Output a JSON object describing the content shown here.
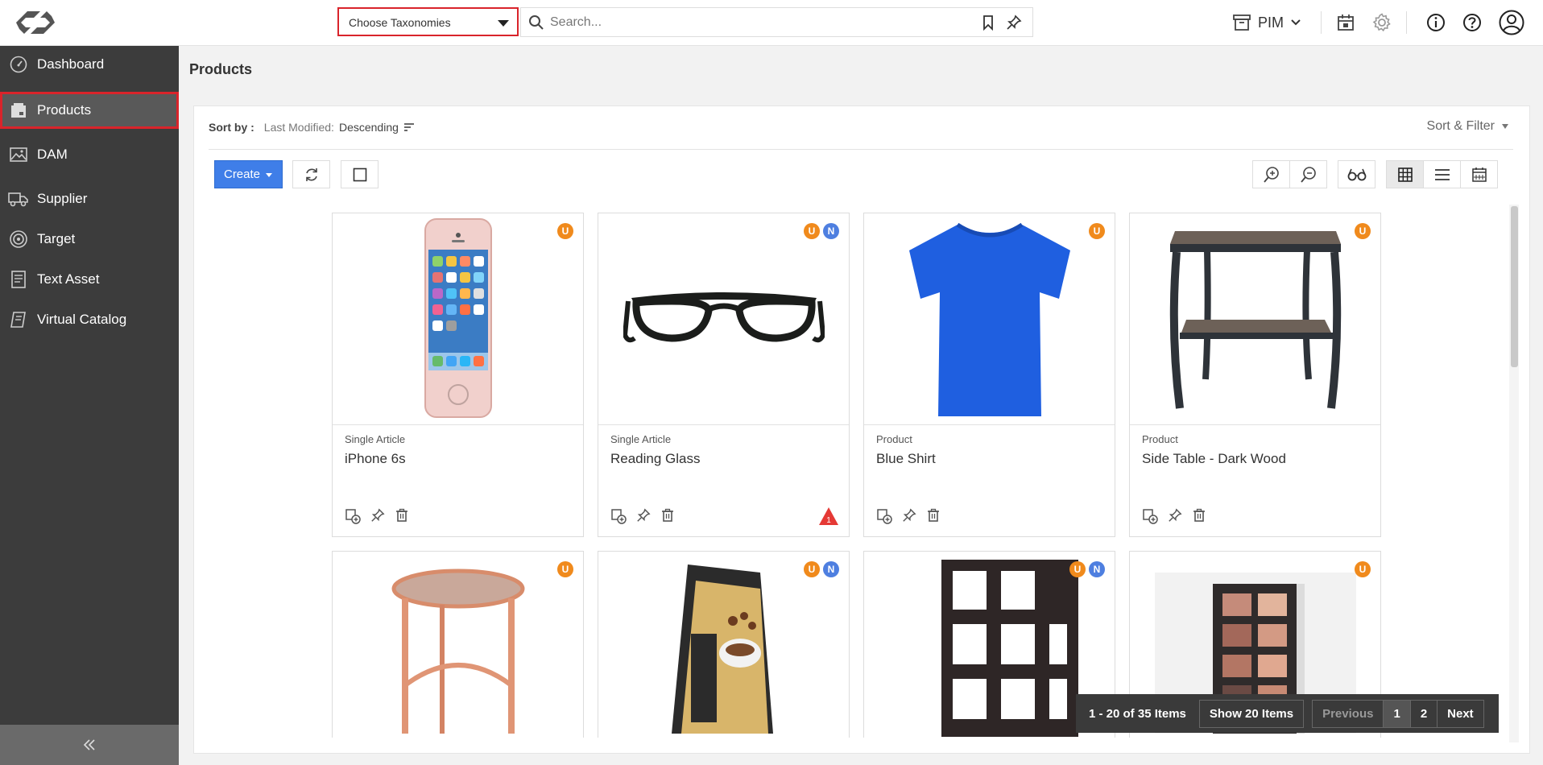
{
  "header": {
    "taxonomy_select": "Choose Taxonomies",
    "search_placeholder": "Search...",
    "workspace": "PIM"
  },
  "sidebar": {
    "items": [
      {
        "label": "Dashboard",
        "icon": "speedometer-icon"
      },
      {
        "label": "Products",
        "icon": "product-box-icon",
        "active": true
      },
      {
        "label": "DAM",
        "icon": "image-icon"
      },
      {
        "label": "Supplier",
        "icon": "truck-icon"
      },
      {
        "label": "Target",
        "icon": "target-icon"
      },
      {
        "label": "Text Asset",
        "icon": "document-icon"
      },
      {
        "label": "Virtual Catalog",
        "icon": "catalog-icon"
      }
    ]
  },
  "page": {
    "title": "Products"
  },
  "sort": {
    "label": "Sort by :",
    "key": "Last Modified:",
    "value": "Descending",
    "filter_label": "Sort & Filter"
  },
  "toolbar": {
    "create_label": "Create"
  },
  "products": [
    {
      "type": "Single Article",
      "name": "iPhone 6s",
      "badges": [
        "U"
      ],
      "warning": null,
      "image": "phone"
    },
    {
      "type": "Single Article",
      "name": "Reading Glass",
      "badges": [
        "U",
        "N"
      ],
      "warning": "1",
      "image": "glasses"
    },
    {
      "type": "Product",
      "name": "Blue Shirt",
      "badges": [
        "U"
      ],
      "warning": null,
      "image": "shirt"
    },
    {
      "type": "Product",
      "name": "Side Table - Dark Wood",
      "badges": [
        "U"
      ],
      "warning": null,
      "image": "table"
    },
    {
      "type": "",
      "name": "",
      "badges": [
        "U"
      ],
      "warning": null,
      "image": "stool"
    },
    {
      "type": "",
      "name": "",
      "badges": [
        "U",
        "N"
      ],
      "warning": null,
      "image": "coffee"
    },
    {
      "type": "",
      "name": "",
      "badges": [
        "U",
        "N"
      ],
      "warning": null,
      "image": "shelf"
    },
    {
      "type": "",
      "name": "",
      "badges": [
        "U"
      ],
      "warning": null,
      "image": "palette"
    }
  ],
  "pager": {
    "info": "1 - 20 of 35 Items",
    "show": "Show 20 Items",
    "previous": "Previous",
    "pages": [
      "1",
      "2"
    ],
    "current_page": "1",
    "next": "Next"
  },
  "colors": {
    "primary": "#3f7ee8",
    "sidebar_bg": "#3c3c3c",
    "highlight_border": "#d9242b",
    "badge_u": "#f08a1c",
    "badge_n": "#4e7fe0",
    "warning": "#e53935"
  }
}
